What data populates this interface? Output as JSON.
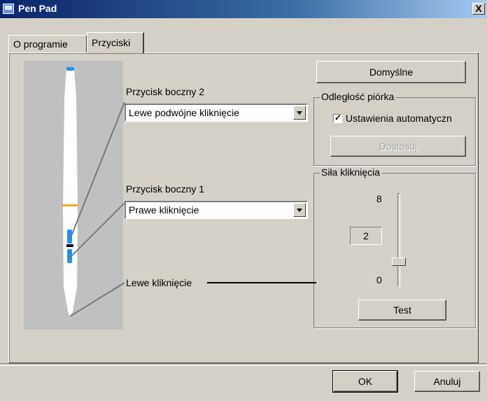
{
  "window": {
    "title": "Pen Pad",
    "close_label": "X"
  },
  "tabs": [
    {
      "label": "O programie",
      "active": false
    },
    {
      "label": "Przyciski",
      "active": true
    }
  ],
  "pen": {
    "side_button_2": {
      "label": "Przycisk boczny 2",
      "selected": "Lewe podwójne kliknięcie"
    },
    "side_button_1": {
      "label": "Przycisk boczny 1",
      "selected": "Prawe kliknięcie"
    },
    "tip_label": "Lewe kliknięcie"
  },
  "buttons": {
    "default": "Domyślne",
    "ok": "OK",
    "cancel": "Anuluj"
  },
  "pen_distance": {
    "legend": "Odległość piórka",
    "auto_settings_label": "Ustawienia automatyczn",
    "auto_settings_checked": true,
    "adjust_label": "Dostosuj",
    "adjust_enabled": false
  },
  "click_force": {
    "legend": "Siła kliknięcia",
    "max_label": "8",
    "min_label": "0",
    "value": "2",
    "test_label": "Test"
  },
  "colors": {
    "titlebar_start": "#0a246a",
    "pen_accent_blue": "#1e90ff",
    "pen_accent_orange": "#f5a623"
  }
}
